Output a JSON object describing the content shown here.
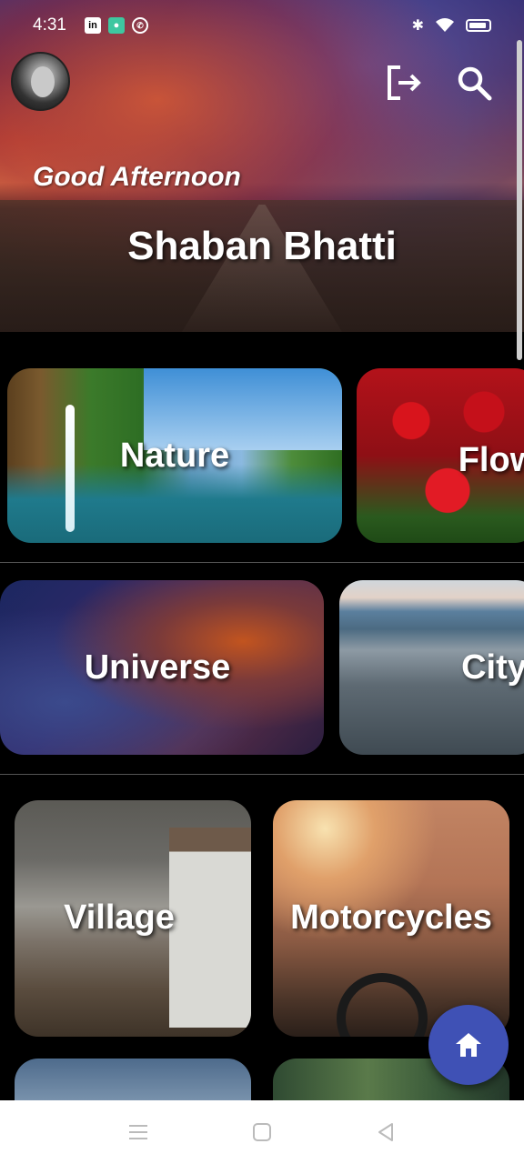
{
  "status_bar": {
    "time": "4:31",
    "apps": [
      "linkedin-icon",
      "chat-app-icon",
      "whatsapp-icon"
    ],
    "indicators": [
      "bluetooth-icon",
      "wifi-icon",
      "battery-icon"
    ]
  },
  "header": {
    "greeting": "Good Afternoon",
    "user_name": "Shaban Bhatti",
    "actions": [
      "logout-icon",
      "search-icon"
    ]
  },
  "categories": [
    {
      "label": "Nature"
    },
    {
      "label": "Flow"
    },
    {
      "label": "Universe"
    },
    {
      "label": "City"
    },
    {
      "label": "Village"
    },
    {
      "label": "Motorcycles"
    }
  ],
  "fab": {
    "icon": "home-icon"
  },
  "navigation": {
    "buttons": [
      "menu-icon",
      "home-square-icon",
      "back-icon"
    ]
  },
  "colors": {
    "fab": "#3f51b5",
    "background": "#000000",
    "divider": "#555555"
  }
}
